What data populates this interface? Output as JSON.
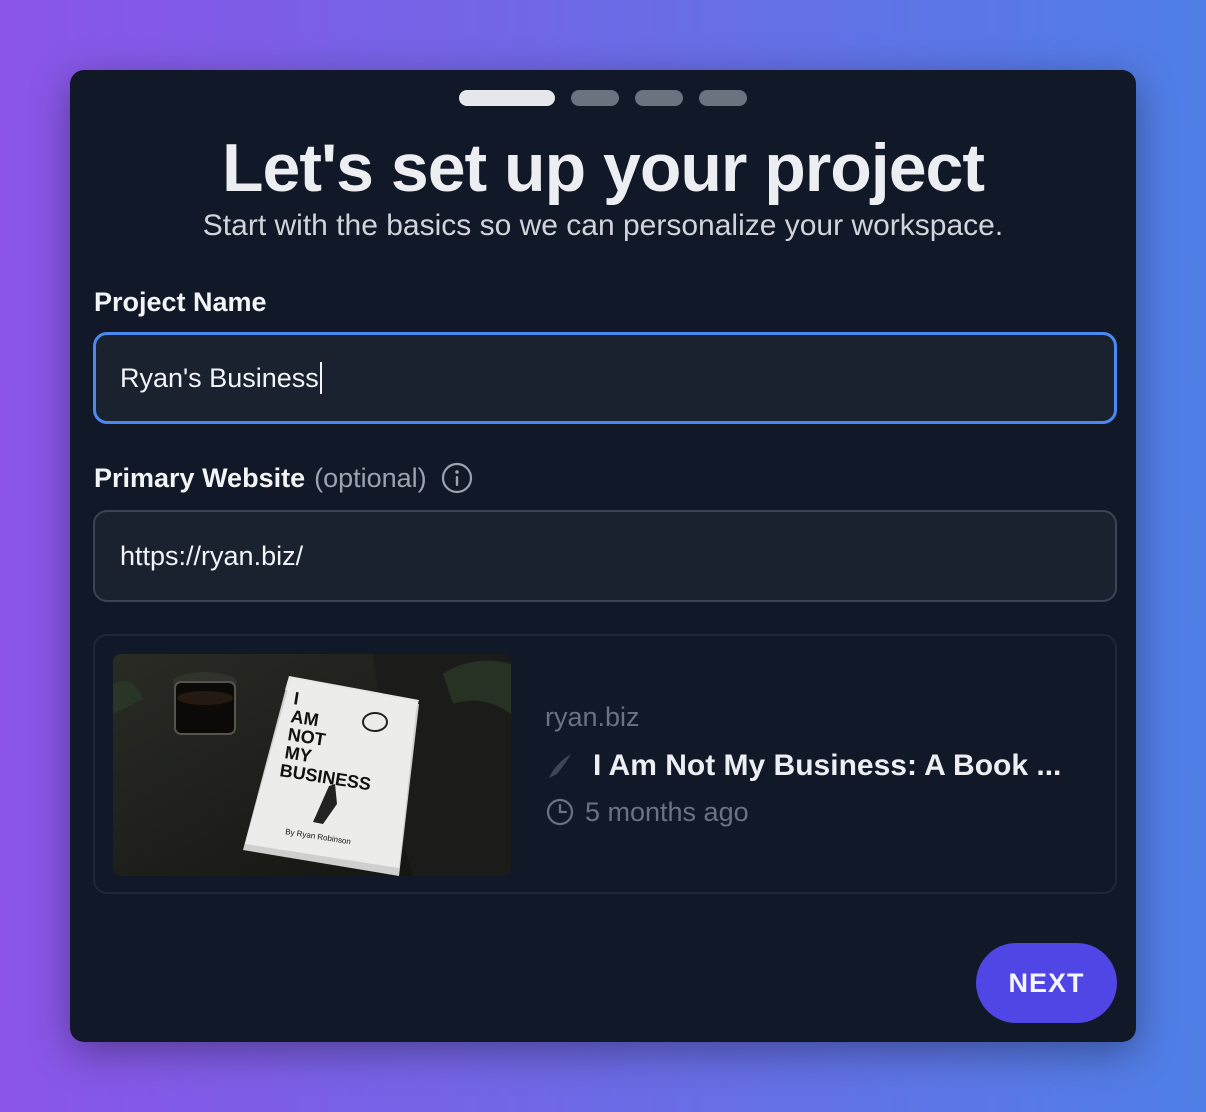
{
  "steps": {
    "total": 4,
    "current": 1
  },
  "header": {
    "title": "Let's set up your project",
    "subtitle": "Start with the basics so we can personalize your workspace."
  },
  "form": {
    "project_name": {
      "label": "Project Name",
      "value": "Ryan's Business"
    },
    "website": {
      "label": "Primary Website",
      "optional_label": "(optional)",
      "value": "https://ryan.biz/",
      "info_icon": "info-icon"
    }
  },
  "preview": {
    "domain": "ryan.biz",
    "title": "I Am Not My Business: A Book ...",
    "time": "5 months ago",
    "thumbnail": {
      "book_title_lines": [
        "I",
        "AM",
        "NOT",
        "MY",
        "BUSINESS"
      ],
      "book_author": "By Ryan Robinson"
    }
  },
  "actions": {
    "next_label": "NEXT"
  },
  "colors": {
    "accent": "#4f46e5",
    "focus_border": "#4a8af0",
    "card_bg": "#111827"
  }
}
